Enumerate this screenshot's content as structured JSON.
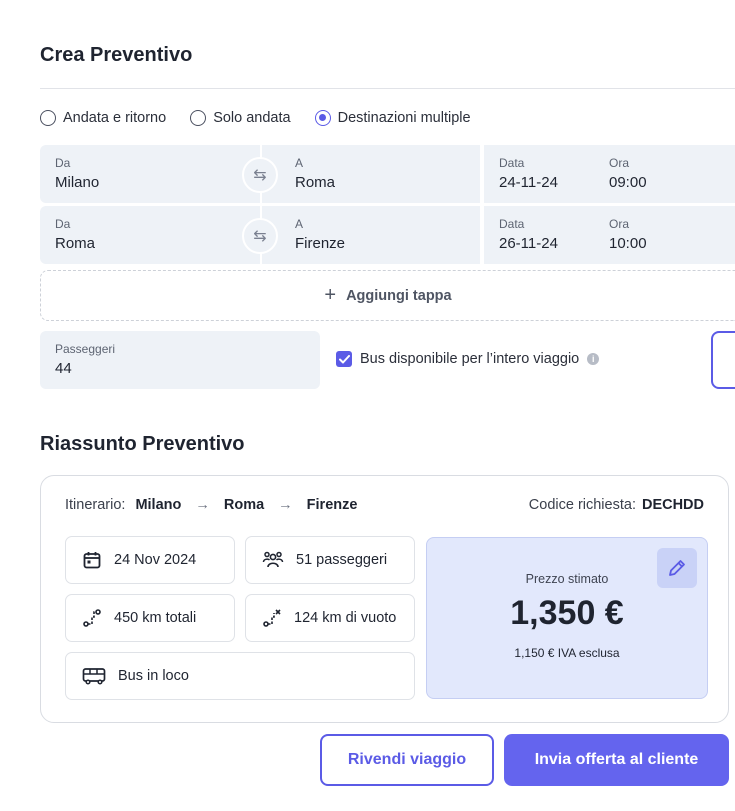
{
  "titles": {
    "create": "Crea Preventivo",
    "summary": "Riassunto Preventivo"
  },
  "trip_types": [
    {
      "label": "Andata e ritorno",
      "selected": false
    },
    {
      "label": "Solo andata",
      "selected": false
    },
    {
      "label": "Destinazioni multiple",
      "selected": true
    }
  ],
  "legs": [
    {
      "from_label": "Da",
      "from": "Milano",
      "to_label": "A",
      "to": "Roma",
      "date_label": "Data",
      "date": "24-11-24",
      "time_label": "Ora",
      "time": "09:00"
    },
    {
      "from_label": "Da",
      "from": "Roma",
      "to_label": "A",
      "to": "Firenze",
      "date_label": "Data",
      "date": "26-11-24",
      "time_label": "Ora",
      "time": "10:00"
    }
  ],
  "add_stop": "Aggiungi tappa",
  "passengers": {
    "label": "Passeggeri",
    "value": "44"
  },
  "bus_checkbox": {
    "label": "Bus disponibile per l’intero viaggio",
    "checked": true,
    "info": "i"
  },
  "summary": {
    "itinerary_label": "Itinerario:",
    "stops": [
      "Milano",
      "Roma",
      "Firenze"
    ],
    "arrow": "→",
    "code_label": "Codice richiesta:",
    "code": "DECHDD",
    "chips": {
      "date": "24 Nov 2024",
      "passengers": "51 passeggeri",
      "total_km": "450 km totali",
      "empty_km": "124 km di vuoto",
      "bus": "Bus in loco"
    },
    "price": {
      "label": "Prezzo stimato",
      "value": "1,350 €",
      "sub": "1,150 €  IVA esclusa"
    }
  },
  "buttons": {
    "resell": "Rivendi viaggio",
    "send": "Invia offerta al cliente"
  },
  "colors": {
    "accent": "#5b5be6",
    "field_bg": "#eef2f7",
    "price_bg": "#e2e8fc"
  }
}
